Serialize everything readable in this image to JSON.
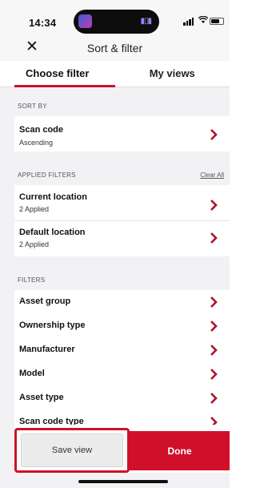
{
  "status_bar": {
    "time": "14:34"
  },
  "header": {
    "title": "Sort & filter",
    "close_icon": "close-icon"
  },
  "tabs": [
    {
      "label": "Choose filter",
      "active": true
    },
    {
      "label": "My views",
      "active": false
    }
  ],
  "sort_by": {
    "heading": "SORT BY",
    "item": {
      "label": "Scan code",
      "value": "Ascending"
    }
  },
  "applied_filters": {
    "heading": "APPLIED FILTERS",
    "clear_all": "Clear All",
    "items": [
      {
        "label": "Current location",
        "value": "2 Applied"
      },
      {
        "label": "Default location",
        "value": "2 Applied"
      }
    ]
  },
  "filters": {
    "heading": "FILTERS",
    "items": [
      {
        "label": "Asset group"
      },
      {
        "label": "Ownership type"
      },
      {
        "label": "Manufacturer"
      },
      {
        "label": "Model"
      },
      {
        "label": "Asset type"
      },
      {
        "label": "Scan code type"
      }
    ]
  },
  "footer": {
    "save_label": "Save view",
    "done_label": "Done"
  },
  "colors": {
    "accent": "#d0102a",
    "background": "#f2f2f4",
    "chevron": "#b0102a"
  }
}
